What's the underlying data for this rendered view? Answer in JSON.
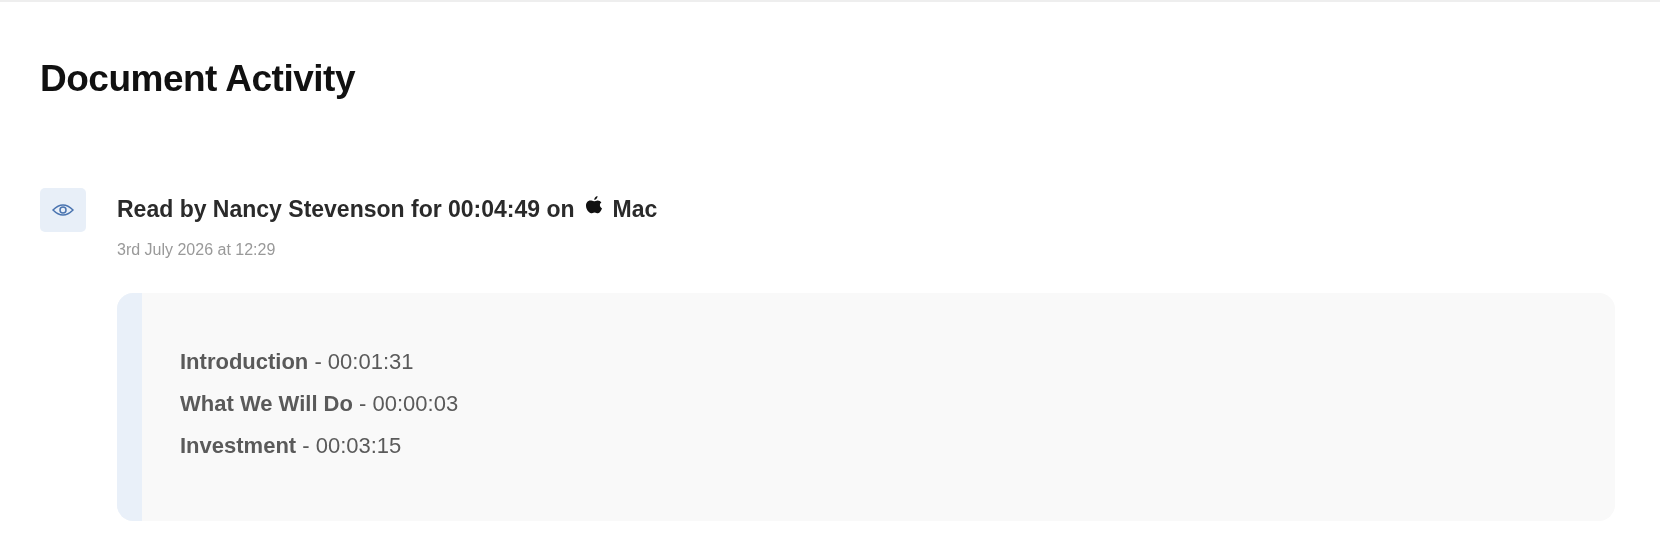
{
  "page_title": "Document Activity",
  "activity": {
    "headline": "Read by Nancy Stevenson for 00:04:49 on",
    "device": "Mac",
    "timestamp": "3rd July 2026 at 12:29",
    "sections": [
      {
        "text": "**Introduction** - 00:01:31"
      },
      {
        "text": "**What We Will Do** - 00:00:03"
      },
      {
        "text": "**Investment** - 00:03:15"
      }
    ]
  }
}
